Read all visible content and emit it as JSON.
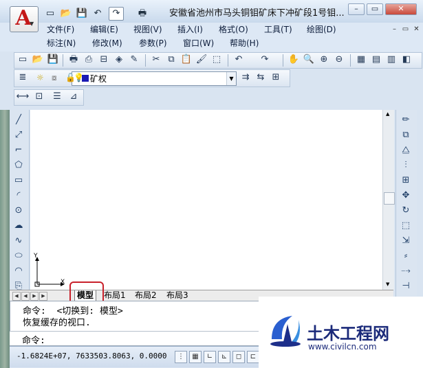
{
  "title_bar": {
    "title": "安徽省池州市马头铜钼矿床下冲矿段1号钼...",
    "logo_letter": "A",
    "quick_access": [
      "new-icon",
      "open-icon",
      "save-icon",
      "undo-icon",
      "redo-icon",
      "plot-icon"
    ]
  },
  "window_controls": {
    "minimize": "–",
    "restore": "▭",
    "close": "✕"
  },
  "menu": {
    "row1": [
      "文件(F)",
      "编辑(E)",
      "视图(V)",
      "插入(I)",
      "格式(O)",
      "工具(T)",
      "绘图(D)"
    ],
    "row2": [
      "标注(N)",
      "修改(M)",
      "参数(P)",
      "窗口(W)",
      "帮助(H)"
    ]
  },
  "doc_controls": {
    "minimize": "–",
    "restore": "▭",
    "close": "✕"
  },
  "layer": {
    "current": "矿权"
  },
  "tabs": {
    "model": "模型",
    "layouts": [
      "布局1",
      "布局2",
      "布局3"
    ]
  },
  "ucs": {
    "x_label": "X",
    "y_label": "Y"
  },
  "command": {
    "history": [
      "命令:  <切换到: 模型>",
      "恢复缓存的视口."
    ],
    "prompt": "命令:"
  },
  "status": {
    "coordinates": "-1.6824E+07,  7633503.8063, 0.0000"
  },
  "watermark": {
    "brand": "土木工程网",
    "url": "www.civilcn.com"
  },
  "colors": {
    "accent_red": "#c8202a",
    "brand_blue": "#1b2a7a"
  }
}
